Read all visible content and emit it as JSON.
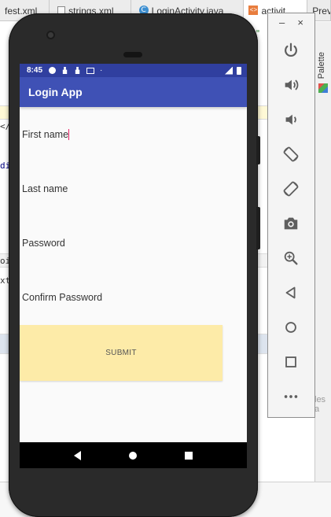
{
  "ide": {
    "tabs": [
      {
        "label": "fest.xml",
        "icon": "file-icon"
      },
      {
        "label": "strings.xml",
        "icon": "file-icon"
      },
      {
        "label": "LoginActivity.java",
        "icon": "class-c-icon"
      },
      {
        "label": "activit",
        "icon": "layout-icon"
      },
      {
        "label": "Prev",
        "icon": ""
      }
    ],
    "snippets": [
      "t\"",
      "</",
      "di",
      "oi",
      "xt",
      "e F"
    ],
    "right_panel_label": "Palette",
    "right_hint": "les a"
  },
  "phone": {
    "status": {
      "time": "8:45",
      "dot": "·"
    },
    "app_title": "Login App",
    "fields": [
      {
        "label": "First name",
        "focused": true
      },
      {
        "label": "Last name",
        "focused": false
      },
      {
        "label": "Password",
        "focused": false
      },
      {
        "label": "Confirm Password",
        "focused": false
      }
    ],
    "submit_label": "SUBMIT",
    "colors": {
      "status_bar": "#303f9f",
      "app_bar": "#3f51b5",
      "submit_bg": "#fdeba8",
      "cursor": "#e91e63"
    }
  },
  "emulator_toolbar": {
    "window_controls": [
      "–",
      "×"
    ],
    "buttons": [
      "power-icon",
      "volume-up-icon",
      "volume-down-icon",
      "rotate-left-icon",
      "rotate-right-icon",
      "camera-icon",
      "zoom-icon",
      "back-icon",
      "home-icon",
      "overview-icon",
      "more-icon"
    ]
  }
}
